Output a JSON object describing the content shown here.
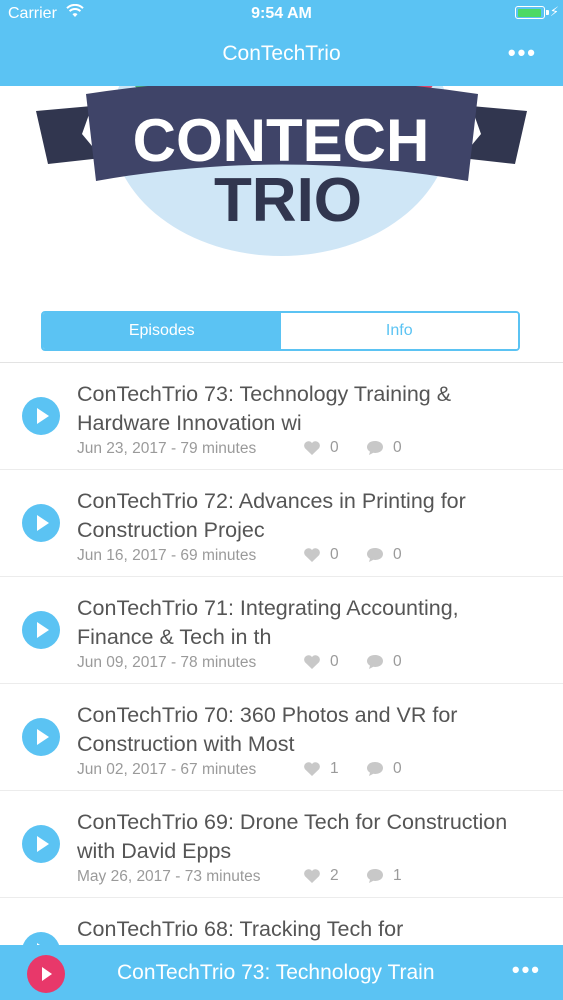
{
  "status_bar": {
    "carrier": "Carrier",
    "time": "9:54 AM"
  },
  "header": {
    "title": "ConTechTrio"
  },
  "banner": {
    "line1": "CONTECH",
    "line2": "TRIO"
  },
  "tabs": [
    {
      "label": "Episodes",
      "active": true
    },
    {
      "label": "Info",
      "active": false
    }
  ],
  "episodes": [
    {
      "title": "ConTechTrio 73: Technology Training & Hardware Innovation wi",
      "meta": "Jun 23, 2017 - 79 minutes",
      "likes": "0",
      "comments": "0"
    },
    {
      "title": "ConTechTrio 72: Advances in Printing for Construction Projec",
      "meta": "Jun 16, 2017 - 69 minutes",
      "likes": "0",
      "comments": "0"
    },
    {
      "title": "ConTechTrio 71: Integrating Accounting, Finance & Tech in th",
      "meta": "Jun 09, 2017 - 78 minutes",
      "likes": "0",
      "comments": "0"
    },
    {
      "title": "ConTechTrio 70: 360 Photos and VR for Construction with Most",
      "meta": "Jun 02, 2017 - 67 minutes",
      "likes": "1",
      "comments": "0"
    },
    {
      "title": "ConTechTrio 69: Drone Tech for Construction with David Epps",
      "meta": "May 26, 2017 - 73 minutes",
      "likes": "2",
      "comments": "1"
    },
    {
      "title": "ConTechTrio 68: Tracking Tech for",
      "meta": "",
      "likes": "",
      "comments": ""
    }
  ],
  "player": {
    "now_playing": "ConTechTrio 73: Technology Train"
  },
  "colors": {
    "accent": "#5bc3f3",
    "play_pink": "#e8386a",
    "banner_ribbon": "#3f4468"
  }
}
